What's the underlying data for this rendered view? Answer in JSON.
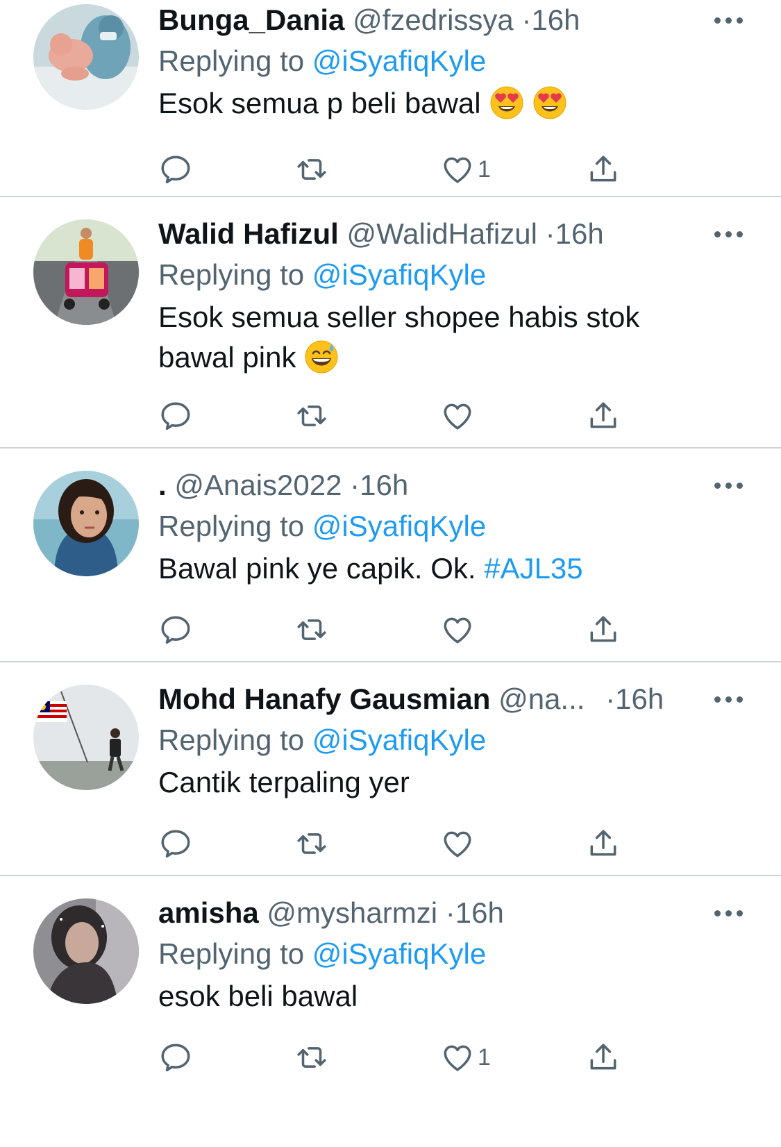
{
  "tweets": [
    {
      "name": "Bunga_Dania",
      "handle": "@fzedrissya",
      "dot": "·",
      "time": "16h",
      "replying_label": "Replying to",
      "replying_to": "@iSyafiqKyle",
      "text": "Esok semua p beli bawal",
      "hashtag": "",
      "emoji": [
        "heart-eyes",
        "heart-eyes"
      ],
      "like_count": "1"
    },
    {
      "name": "Walid Hafizul",
      "handle": "@WalidHafizul",
      "dot": "·",
      "time": "16h",
      "replying_label": "Replying to",
      "replying_to": "@iSyafiqKyle",
      "text": "Esok semua seller shopee habis stok bawal pink",
      "hashtag": "",
      "emoji": [
        "grin-sweat"
      ],
      "like_count": ""
    },
    {
      "name": ".",
      "handle": "@Anais2022",
      "dot": "·",
      "time": "16h",
      "replying_label": "Replying to",
      "replying_to": "@iSyafiqKyle",
      "text": "Bawal pink ye capik. Ok.",
      "hashtag": "#AJL35",
      "emoji": [],
      "like_count": ""
    },
    {
      "name": "Mohd Hanafy Gausmian",
      "handle": "@na...",
      "dot": "·",
      "time": "16h",
      "replying_label": "Replying to",
      "replying_to": "@iSyafiqKyle",
      "text": "Cantik terpaling yer",
      "hashtag": "",
      "emoji": [],
      "like_count": ""
    },
    {
      "name": "amisha",
      "handle": "@mysharmzi",
      "dot": "·",
      "time": "16h",
      "replying_label": "Replying to",
      "replying_to": "@iSyafiqKyle",
      "text": "esok beli bawal",
      "hashtag": "",
      "emoji": [],
      "like_count": "1"
    }
  ],
  "colors": {
    "text": "#0f1419",
    "secondary": "#536471",
    "link": "#1d9bf0",
    "divider": "#cfd3d7"
  },
  "icons": [
    "reply-icon",
    "retweet-icon",
    "like-icon",
    "share-icon",
    "more-options-icon"
  ]
}
